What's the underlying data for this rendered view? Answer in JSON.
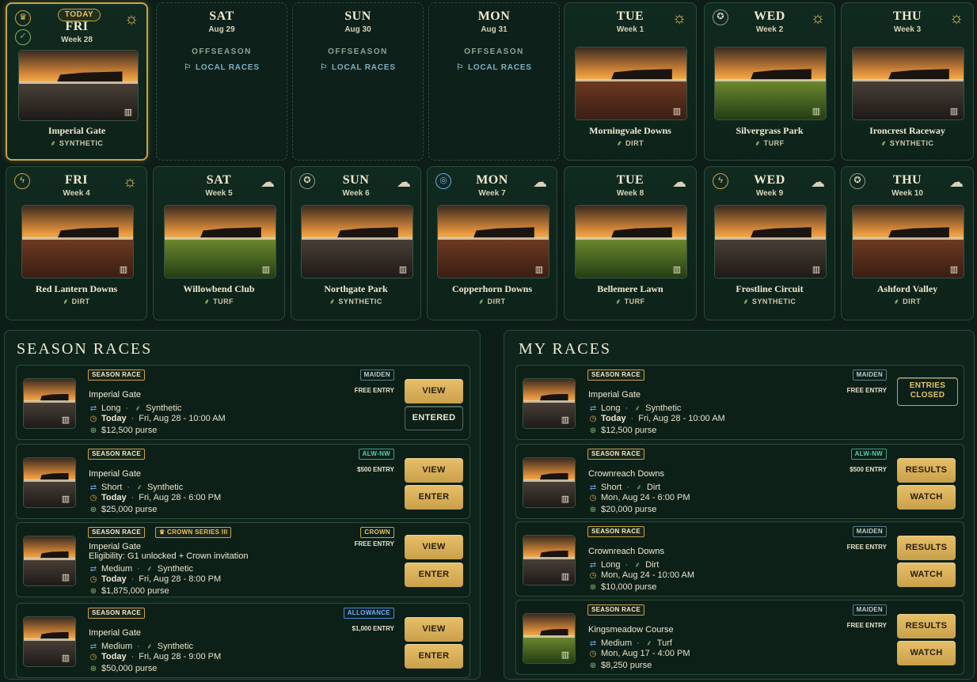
{
  "calendar": {
    "today_badge": "TODAY",
    "row1": [
      {
        "day": "FRI",
        "sub": "Week 28",
        "track": "Imperial Gate",
        "surface": "SYNTHETIC",
        "ground": "syn",
        "weather": "sun",
        "icon": "crown"
      },
      {
        "day": "SAT",
        "sub": "Aug 29",
        "offseason": "OFFSEASON",
        "local": "LOCAL RACES"
      },
      {
        "day": "SUN",
        "sub": "Aug 30",
        "offseason": "OFFSEASON",
        "local": "LOCAL RACES"
      },
      {
        "day": "MON",
        "sub": "Aug 31",
        "offseason": "OFFSEASON",
        "local": "LOCAL RACES"
      },
      {
        "day": "TUE",
        "sub": "Week 1",
        "track": "Morningvale Downs",
        "surface": "DIRT",
        "ground": "dirt",
        "weather": "sun"
      },
      {
        "day": "WED",
        "sub": "Week 2",
        "track": "Silvergrass Park",
        "surface": "TURF",
        "ground": "turf",
        "weather": "sun",
        "icon": "ribbon"
      },
      {
        "day": "THU",
        "sub": "Week 3",
        "track": "Ironcrest Raceway",
        "surface": "SYNTHETIC",
        "ground": "syn",
        "weather": "sun"
      }
    ],
    "row2": [
      {
        "day": "FRI",
        "sub": "Week 4",
        "track": "Red Lantern Downs",
        "surface": "DIRT",
        "ground": "dirt",
        "weather": "sun",
        "icon": "bolt"
      },
      {
        "day": "SAT",
        "sub": "Week 5",
        "track": "Willowbend Club",
        "surface": "TURF",
        "ground": "turf",
        "weather": "cloud"
      },
      {
        "day": "SUN",
        "sub": "Week 6",
        "track": "Northgate Park",
        "surface": "SYNTHETIC",
        "ground": "syn",
        "weather": "cloud",
        "icon": "ribbon"
      },
      {
        "day": "MON",
        "sub": "Week 7",
        "track": "Copperhorn Downs",
        "surface": "DIRT",
        "ground": "dirt",
        "weather": "cloud",
        "icon": "target"
      },
      {
        "day": "TUE",
        "sub": "Week 8",
        "track": "Bellemere Lawn",
        "surface": "TURF",
        "ground": "turf",
        "weather": "cloud"
      },
      {
        "day": "WED",
        "sub": "Week 9",
        "track": "Frostline Circuit",
        "surface": "SYNTHETIC",
        "ground": "syn",
        "weather": "cloud",
        "icon": "bolt"
      },
      {
        "day": "THU",
        "sub": "Week 10",
        "track": "Ashford Valley",
        "surface": "DIRT",
        "ground": "dirt",
        "weather": "cloud",
        "icon": "ribbon"
      }
    ]
  },
  "season_races": {
    "title": "SEASON RACES",
    "items": [
      {
        "tag": "SEASON RACE",
        "type": "MAIDEN",
        "entry": "FREE ENTRY",
        "track": "Imperial Gate",
        "dist": "Long",
        "surface": "Synthetic",
        "when_today": "Today",
        "when": "Fri, Aug 28 - 10:00 AM",
        "purse": "$12,500 purse",
        "btn1": "VIEW",
        "btn2": "ENTERED",
        "ground": "syn"
      },
      {
        "tag": "SEASON RACE",
        "type": "ALW-NW",
        "entry": "$500 ENTRY",
        "track": "Imperial Gate",
        "dist": "Short",
        "surface": "Synthetic",
        "when_today": "Today",
        "when": "Fri, Aug 28 - 6:00 PM",
        "purse": "$25,000 purse",
        "btn1": "VIEW",
        "btn2": "ENTER",
        "ground": "syn"
      },
      {
        "tag": "SEASON RACE",
        "tag2": "CROWN SERIES III",
        "type": "CROWN",
        "entry": "FREE ENTRY",
        "track": "Imperial Gate",
        "elig": "Eligibility: G1 unlocked + Crown invitation",
        "dist": "Medium",
        "surface": "Synthetic",
        "when_today": "Today",
        "when": "Fri, Aug 28 - 8:00 PM",
        "purse": "$1,875,000 purse",
        "btn1": "VIEW",
        "btn2": "ENTER",
        "ground": "syn"
      },
      {
        "tag": "SEASON RACE",
        "type": "ALLOWANCE",
        "entry": "$1,000 ENTRY",
        "track": "Imperial Gate",
        "dist": "Medium",
        "surface": "Synthetic",
        "when_today": "Today",
        "when": "Fri, Aug 28 - 9:00 PM",
        "purse": "$50,000 purse",
        "btn1": "VIEW",
        "btn2": "ENTER",
        "ground": "syn"
      }
    ]
  },
  "my_races": {
    "title": "MY RACES",
    "items": [
      {
        "tag": "SEASON RACE",
        "type": "MAIDEN",
        "entry": "FREE ENTRY",
        "track": "Imperial Gate",
        "dist": "Long",
        "surface": "Synthetic",
        "when_today": "Today",
        "when": "Fri, Aug 28 - 10:00 AM",
        "purse": "$12,500 purse",
        "btn1": "ENTRIES CLOSED",
        "ground": "syn"
      },
      {
        "tag": "SEASON RACE",
        "type": "ALW-NW",
        "entry": "$500 ENTRY",
        "track": "Crownreach Downs",
        "dist": "Short",
        "surface": "Dirt",
        "when": "Mon, Aug 24 - 6:00 PM",
        "purse": "$20,000 purse",
        "btn1": "RESULTS",
        "btn2": "WATCH",
        "ground": "syn"
      },
      {
        "tag": "SEASON RACE",
        "type": "MAIDEN",
        "entry": "FREE ENTRY",
        "track": "Crownreach Downs",
        "dist": "Long",
        "surface": "Dirt",
        "when": "Mon, Aug 24 - 10:00 AM",
        "purse": "$10,000 purse",
        "btn1": "RESULTS",
        "btn2": "WATCH",
        "ground": "syn"
      },
      {
        "tag": "SEASON RACE",
        "type": "MAIDEN",
        "entry": "FREE ENTRY",
        "track": "Kingsmeadow Course",
        "dist": "Medium",
        "surface": "Turf",
        "when": "Mon, Aug 17 - 4:00 PM",
        "purse": "$8,250 purse",
        "btn1": "RESULTS",
        "btn2": "WATCH",
        "ground": "turf"
      }
    ]
  }
}
